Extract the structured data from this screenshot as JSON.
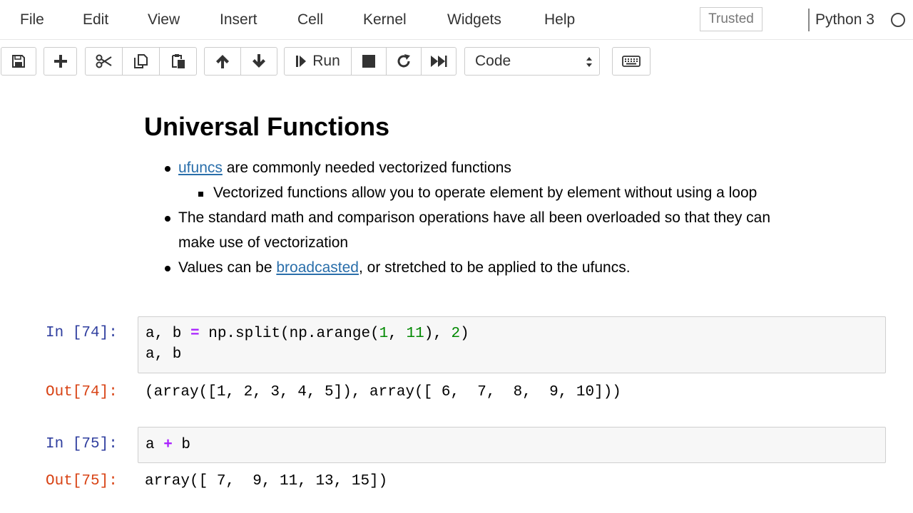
{
  "menubar": {
    "items": [
      "File",
      "Edit",
      "View",
      "Insert",
      "Cell",
      "Kernel",
      "Widgets",
      "Help"
    ],
    "trusted": "Trusted",
    "kernel_name": "Python 3"
  },
  "toolbar": {
    "run_label": "Run",
    "cell_type": "Code",
    "icons": [
      "save-icon",
      "plus-icon",
      "scissors-icon",
      "copy-icon",
      "paste-icon",
      "arrow-up-icon",
      "arrow-down-icon",
      "step-forward-icon",
      "stop-icon",
      "restart-icon",
      "fast-forward-icon",
      "keyboard-icon"
    ]
  },
  "markdown": {
    "title": "Universal Functions",
    "bullet1": {
      "link": "ufuncs",
      "text": " are commonly needed vectorized functions"
    },
    "subbullet1": "Vectorized functions allow you to operate element by element without using a loop",
    "bullet2_line1": "The standard math and comparison operations have all been overloaded so that they can",
    "bullet2_line2": "make use of vectorization",
    "bullet3": {
      "before": "Values can be ",
      "link": "broadcasted",
      "after": ", or stretched to be applied to the ufuncs."
    }
  },
  "cells": [
    {
      "in_prompt": "In [74]:",
      "code": {
        "l1_a": "a, b ",
        "l1_op": "=",
        "l1_b": " np.split(np.arange(",
        "l1_n1": "1",
        "l1_c": ", ",
        "l1_n2": "11",
        "l1_d": "), ",
        "l1_n3": "2",
        "l1_e": ")",
        "l2": "a, b"
      },
      "out_prompt": "Out[74]:",
      "output": "(array([1, 2, 3, 4, 5]), array([ 6,  7,  8,  9, 10]))"
    },
    {
      "in_prompt": "In [75]:",
      "code": {
        "l1_a": "a ",
        "l1_op": "+",
        "l1_b": " b"
      },
      "out_prompt": "Out[75]:",
      "output": "array([ 7,  9, 11, 13, 15])"
    }
  ]
}
